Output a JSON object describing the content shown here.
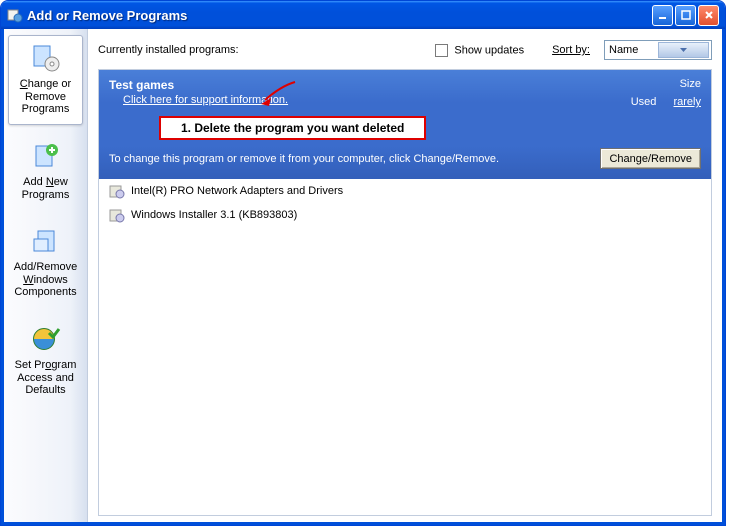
{
  "window": {
    "title": "Add or Remove Programs",
    "min_tooltip": "Minimize",
    "max_tooltip": "Maximize",
    "close_tooltip": "Close"
  },
  "sidebar": {
    "items": [
      {
        "line1": "Change or",
        "line2": "Remove",
        "line3": "Programs",
        "key": "C"
      },
      {
        "line1": "Add ",
        "ukey": "N",
        "line1b": "ew",
        "line2": "Programs"
      },
      {
        "line1": "Add/Remove",
        "line2": "",
        "ukey": "W",
        "line2b": "indows",
        "line3": "Components"
      },
      {
        "line1": "Set Pr",
        "ukey": "o",
        "line1b": "gram",
        "line2": "Access and",
        "line3": "Defaults"
      }
    ]
  },
  "toolbar": {
    "installed_label": "Currently installed programs:",
    "show_updates_label": "Show updates",
    "sortby_label": "Sort by:",
    "sort_value": "Name"
  },
  "selected": {
    "name": "Test games",
    "support_link": "Click here for support information.",
    "size_header": "Size",
    "used_label": "Used",
    "used_value": "rarely",
    "change_text": "To change this program or remove it from your computer, click Change/Remove.",
    "button_label": "Change/Remove"
  },
  "annotation": {
    "text": "1. Delete the program you want deleted"
  },
  "programs": [
    {
      "name": "Intel(R) PRO Network Adapters and Drivers"
    },
    {
      "name": "Windows Installer 3.1 (KB893803)"
    }
  ]
}
